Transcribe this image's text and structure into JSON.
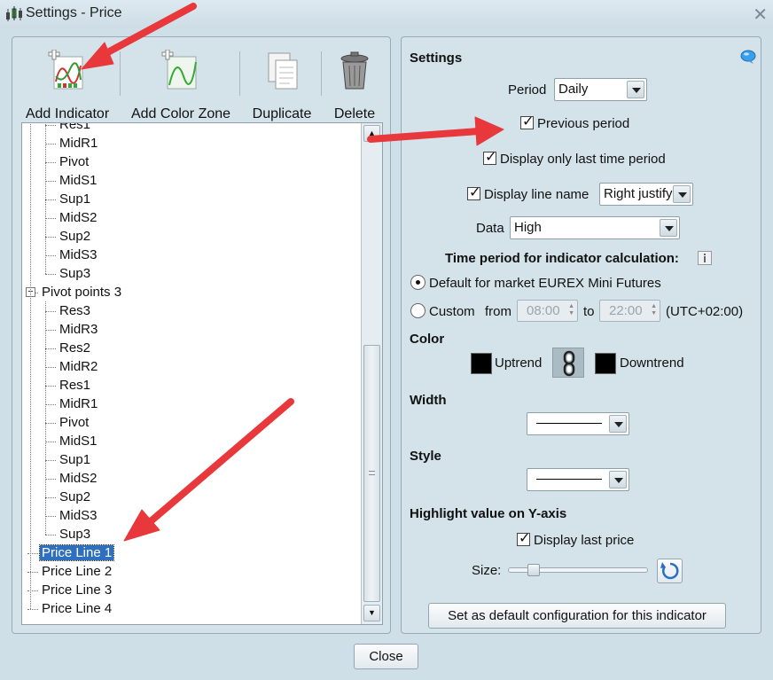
{
  "window": {
    "title": "Settings - Price"
  },
  "toolbar": {
    "add_indicator": "Add Indicator",
    "add_color_zone": "Add Color Zone",
    "duplicate": "Duplicate",
    "delete": "Delete"
  },
  "tree": {
    "items": [
      "Res1",
      "MidR1",
      "Pivot",
      "MidS1",
      "Sup1",
      "MidS2",
      "Sup2",
      "MidS3",
      "Sup3",
      "Pivot points 3",
      "Res3",
      "MidR3",
      "Res2",
      "MidR2",
      "Res1",
      "MidR1",
      "Pivot",
      "MidS1",
      "Sup1",
      "MidS2",
      "Sup2",
      "MidS3",
      "Sup3",
      "Price Line 1",
      "Price Line 2",
      "Price Line 3",
      "Price Line 4"
    ],
    "collapse_symbol": "−",
    "selected": "Price Line 1"
  },
  "settings": {
    "heading": "Settings",
    "period_label": "Period",
    "period_value": "Daily",
    "previous_period": "Previous period",
    "previous_period_checked": true,
    "display_last_time": "Display only last time period",
    "display_last_time_checked": true,
    "display_line_name": "Display line name",
    "display_line_name_checked": true,
    "line_name_position": "Right justify",
    "data_label": "Data",
    "data_value": "High",
    "time_period_heading": "Time period for indicator calculation:",
    "radio_default": "Default for market EUREX Mini Futures",
    "radio_custom": "Custom",
    "from_label": "from",
    "from_time": "08:00",
    "to_label": "to",
    "to_time": "22:00",
    "timezone": "(UTC+02:00)",
    "color_heading": "Color",
    "uptrend_label": "Uptrend",
    "downtrend_label": "Downtrend",
    "uptrend_color": "#000000",
    "downtrend_color": "#000000",
    "width_heading": "Width",
    "style_heading": "Style",
    "highlight_heading": "Highlight value on Y-axis",
    "display_last_price": "Display last price",
    "display_last_price_checked": true,
    "size_label": "Size:",
    "size_level": 0.15,
    "default_button": "Set as default configuration for this indicator"
  },
  "footer": {
    "close_button": "Close"
  },
  "colors": {
    "selection": "#2f6fbf",
    "annotation_arrow": "#e8383b",
    "panel": "#d4e2ea"
  },
  "icons": [
    "app-chart-icon",
    "window-close-icon",
    "add-indicator-icon",
    "add-color-zone-icon",
    "duplicate-icon",
    "trash-icon",
    "help-bubble-icon",
    "info-icon",
    "link-chain-icon",
    "reset-icon"
  ]
}
